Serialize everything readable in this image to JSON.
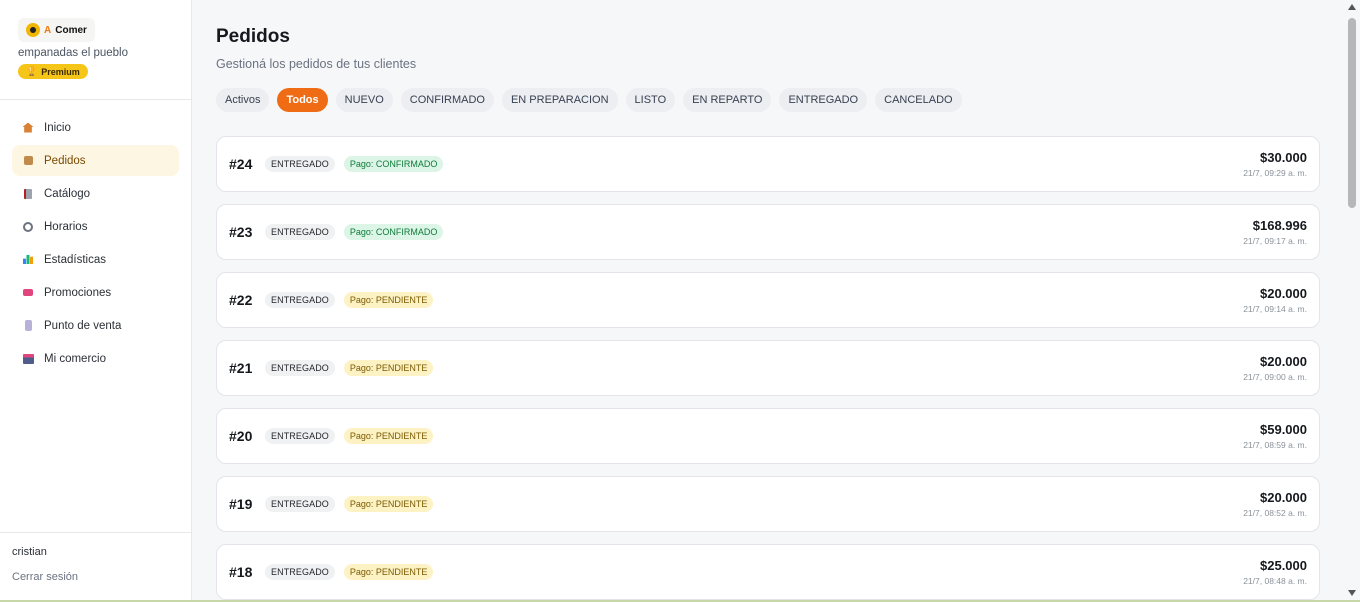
{
  "sidebar": {
    "logo": {
      "prefix": "A",
      "name": "Comer"
    },
    "store_name": "empanadas el pueblo",
    "plan_badge": "Premium",
    "items": [
      {
        "label": "Inicio",
        "icon": "home-icon",
        "active": false
      },
      {
        "label": "Pedidos",
        "icon": "box-icon",
        "active": true
      },
      {
        "label": "Catálogo",
        "icon": "book-icon",
        "active": false
      },
      {
        "label": "Horarios",
        "icon": "clock-icon",
        "active": false
      },
      {
        "label": "Estadísticas",
        "icon": "chart-icon",
        "active": false
      },
      {
        "label": "Promociones",
        "icon": "tag-icon",
        "active": false
      },
      {
        "label": "Punto de venta",
        "icon": "phone-icon",
        "active": false
      },
      {
        "label": "Mi comercio",
        "icon": "shop-icon",
        "active": false
      }
    ],
    "user": "cristian",
    "logout": "Cerrar sesión"
  },
  "header": {
    "title": "Pedidos",
    "subtitle": "Gestioná los pedidos de tus clientes"
  },
  "filters": [
    {
      "label": "Activos",
      "active": false
    },
    {
      "label": "Todos",
      "active": true
    },
    {
      "label": "NUEVO",
      "active": false
    },
    {
      "label": "CONFIRMADO",
      "active": false
    },
    {
      "label": "EN PREPARACION",
      "active": false
    },
    {
      "label": "LISTO",
      "active": false
    },
    {
      "label": "EN REPARTO",
      "active": false
    },
    {
      "label": "ENTREGADO",
      "active": false
    },
    {
      "label": "CANCELADO",
      "active": false
    }
  ],
  "orders": [
    {
      "id": "#24",
      "status": "ENTREGADO",
      "payment": "Pago: CONFIRMADO",
      "payment_state": "ok",
      "amount": "$30.000",
      "date": "21/7, 09:29 a. m."
    },
    {
      "id": "#23",
      "status": "ENTREGADO",
      "payment": "Pago: CONFIRMADO",
      "payment_state": "ok",
      "amount": "$168.996",
      "date": "21/7, 09:17 a. m."
    },
    {
      "id": "#22",
      "status": "ENTREGADO",
      "payment": "Pago: PENDIENTE",
      "payment_state": "pending",
      "amount": "$20.000",
      "date": "21/7, 09:14 a. m."
    },
    {
      "id": "#21",
      "status": "ENTREGADO",
      "payment": "Pago: PENDIENTE",
      "payment_state": "pending",
      "amount": "$20.000",
      "date": "21/7, 09:00 a. m."
    },
    {
      "id": "#20",
      "status": "ENTREGADO",
      "payment": "Pago: PENDIENTE",
      "payment_state": "pending",
      "amount": "$59.000",
      "date": "21/7, 08:59 a. m."
    },
    {
      "id": "#19",
      "status": "ENTREGADO",
      "payment": "Pago: PENDIENTE",
      "payment_state": "pending",
      "amount": "$20.000",
      "date": "21/7, 08:52 a. m."
    },
    {
      "id": "#18",
      "status": "ENTREGADO",
      "payment": "Pago: PENDIENTE",
      "payment_state": "pending",
      "amount": "$25.000",
      "date": "21/7, 08:48 a. m."
    }
  ],
  "colors": {
    "accent": "#ef6c15",
    "premium": "#f5c518",
    "pay_confirmed": "#0f7a3a",
    "pay_pending": "#7a5a00"
  }
}
